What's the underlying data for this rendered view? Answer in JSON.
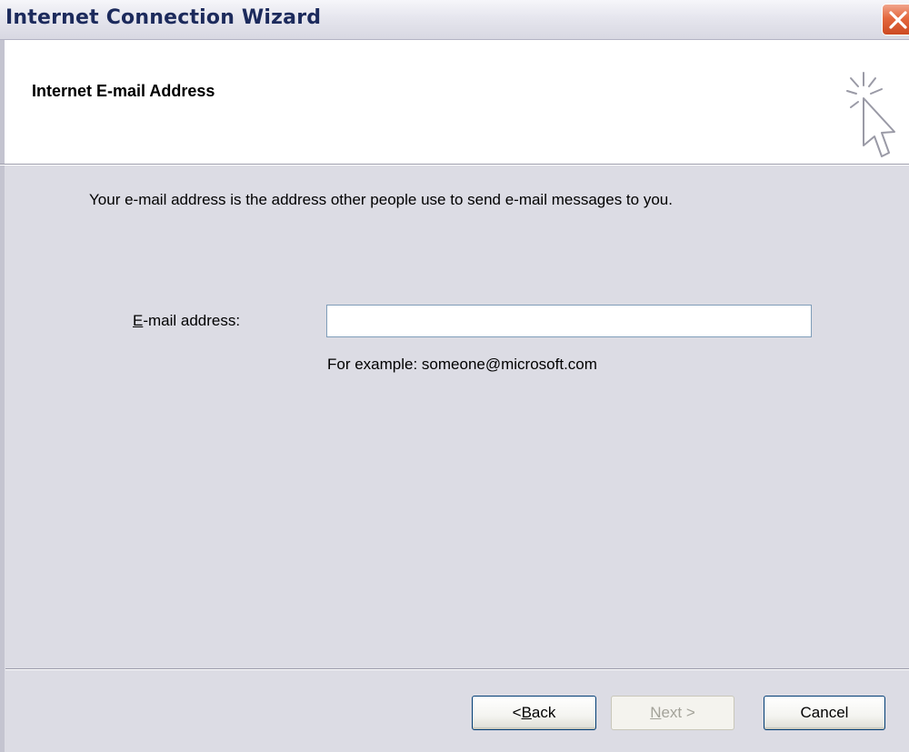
{
  "window": {
    "title": "Internet Connection Wizard",
    "close_icon": "close-icon"
  },
  "header": {
    "title": "Internet E-mail Address",
    "icon": "cursor-sparkle-icon"
  },
  "main": {
    "description": "Your e-mail address is the address other people use to send e-mail messages to you.",
    "email_label_mnemonic": "E",
    "email_label_rest": "-mail address:",
    "email_value": "",
    "example": "For example: someone@microsoft.com"
  },
  "buttons": {
    "back_prefix": "< ",
    "back_mnemonic": "B",
    "back_rest": "ack",
    "next_mnemonic": "N",
    "next_rest": "ext >",
    "cancel": "Cancel"
  },
  "colors": {
    "title_text": "#1c2a5c",
    "close_button": "#e4683e",
    "dialog_background": "#dcdce4",
    "button_border": "#003c74"
  }
}
